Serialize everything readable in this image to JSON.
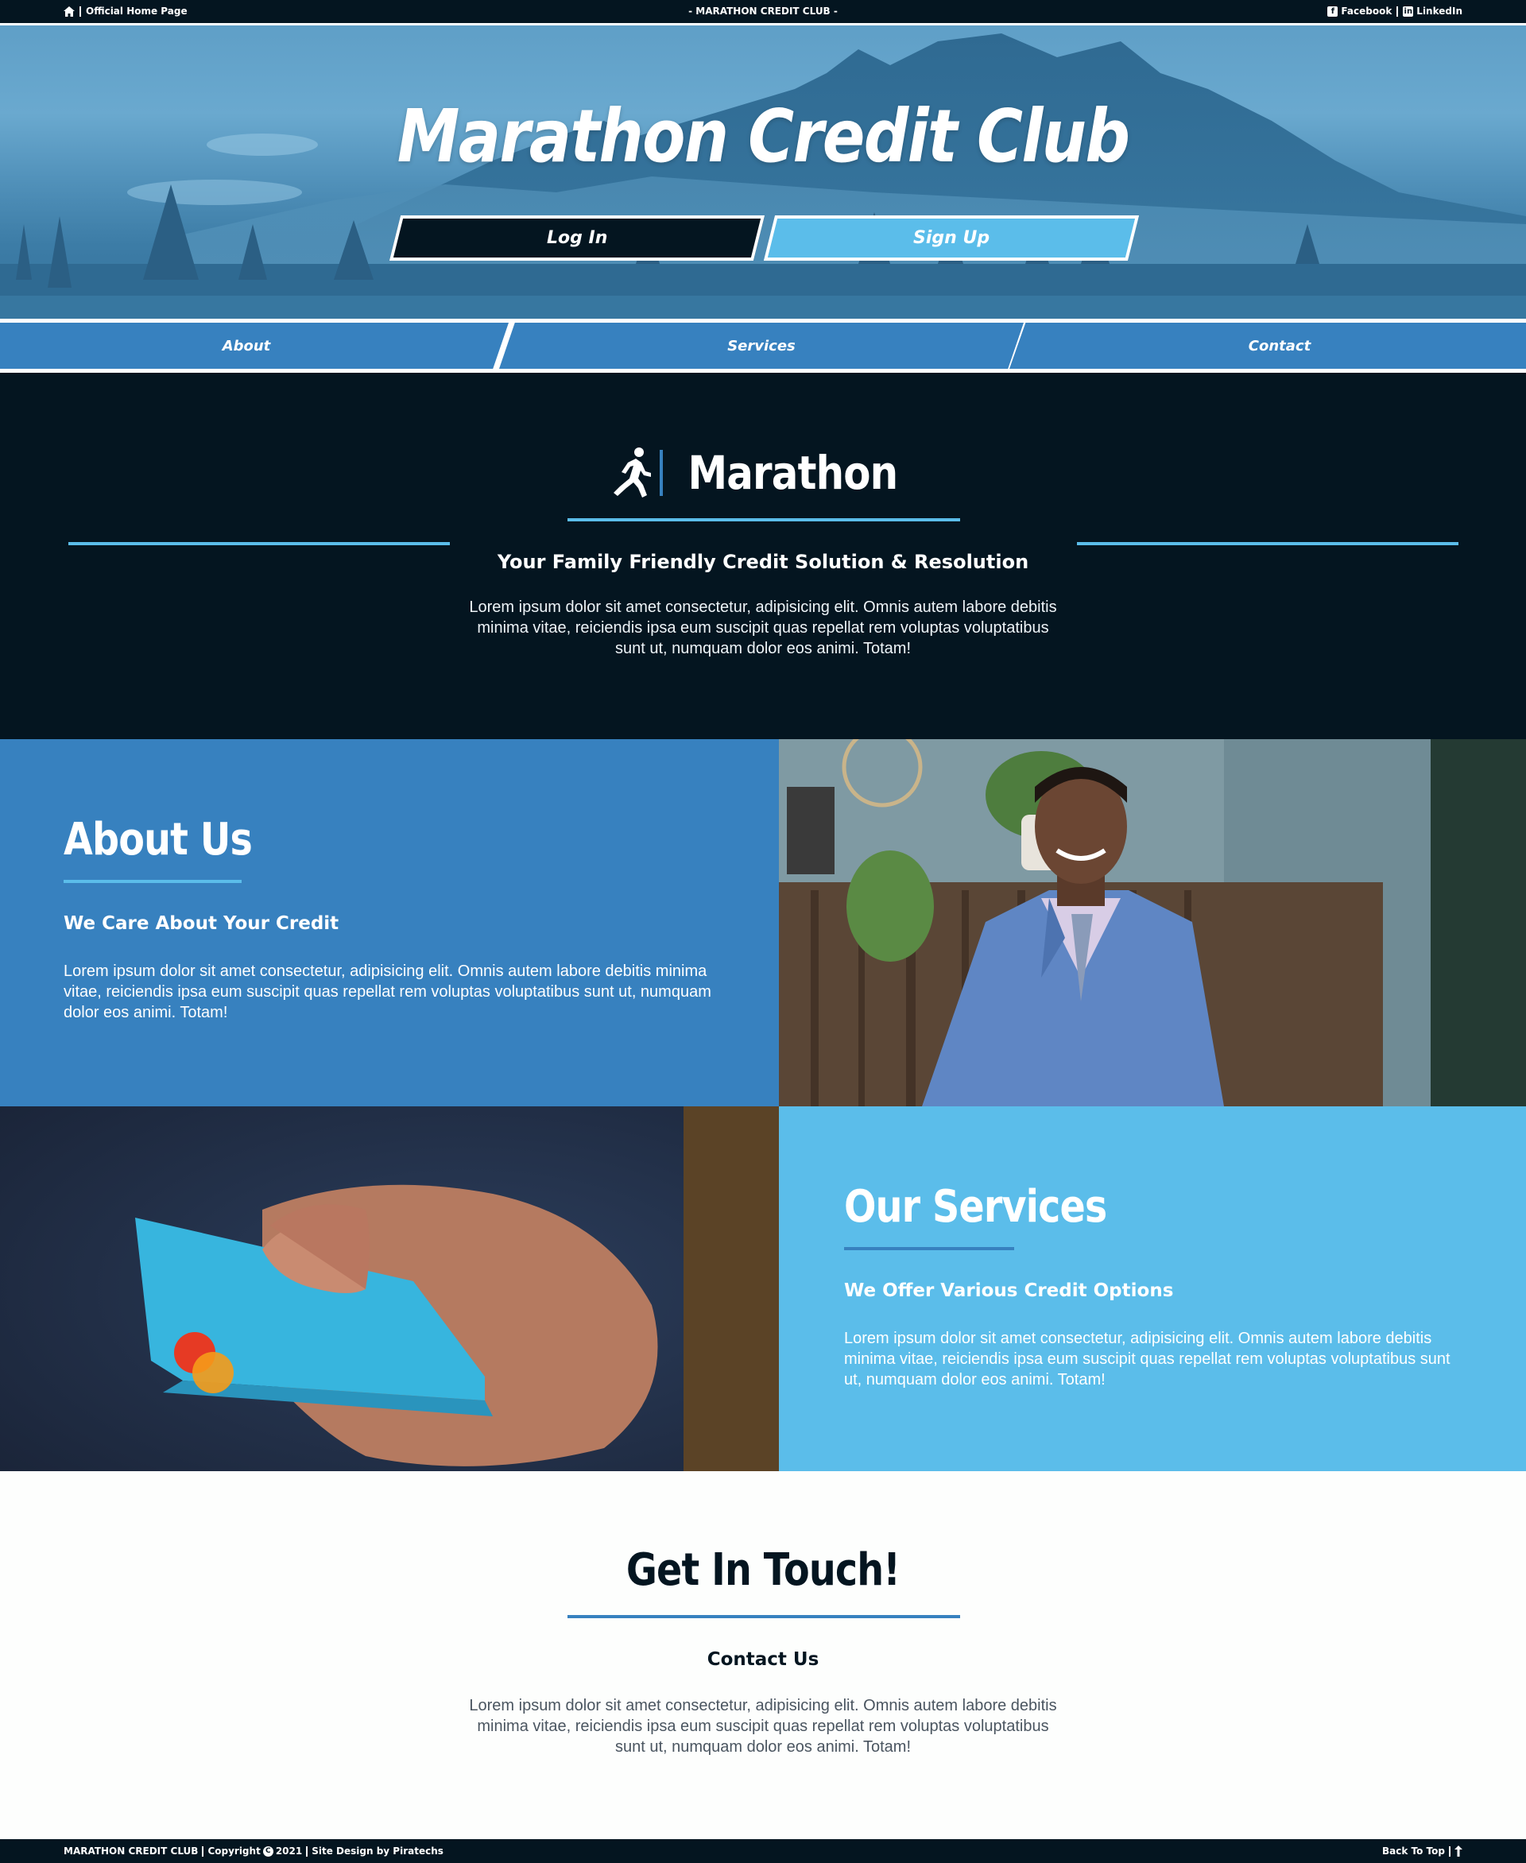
{
  "topbar": {
    "home_label": "Official Home Page",
    "center_label": "- MARATHON CREDIT CLUB -",
    "facebook_label": "Facebook",
    "linkedin_label": "LinkedIn"
  },
  "hero": {
    "title": "Marathon Credit Club",
    "login_label": "Log In",
    "signup_label": "Sign Up"
  },
  "nav": {
    "items": [
      {
        "label": "About"
      },
      {
        "label": "Services"
      },
      {
        "label": "Contact"
      }
    ]
  },
  "intro": {
    "brand": "Marathon",
    "subtitle": "Your Family Friendly Credit Solution & Resolution",
    "text": "Lorem ipsum dolor sit amet consectetur, adipisicing elit. Omnis autem labore debitis minima vitae, reiciendis ipsa eum suscipit quas repellat rem voluptas voluptatibus sunt ut, numquam dolor eos animi. Totam!"
  },
  "about": {
    "title": "About Us",
    "subtitle": "We Care About Your Credit",
    "text": "Lorem ipsum dolor sit amet consectetur, adipisicing elit. Omnis autem labore debitis minima vitae, reiciendis ipsa eum suscipit quas repellat rem voluptas voluptatibus sunt ut, numquam dolor eos animi. Totam!"
  },
  "services": {
    "title": "Our Services",
    "subtitle": "We Offer Various Credit Options",
    "text": "Lorem ipsum dolor sit amet consectetur, adipisicing elit. Omnis autem labore debitis minima vitae, reiciendis ipsa eum suscipit quas repellat rem voluptas voluptatibus sunt ut, numquam dolor eos animi. Totam!"
  },
  "contact": {
    "title": "Get In Touch!",
    "subtitle": "Contact Us",
    "text": "Lorem ipsum dolor sit amet consectetur, adipisicing elit. Omnis autem labore debitis minima vitae, reiciendis ipsa eum suscipit quas repellat rem voluptas voluptatibus sunt ut, numquam dolor eos animi. Totam!"
  },
  "footer": {
    "brand": "MARATHON CREDIT CLUB",
    "copyright_label": "Copyright",
    "year": "2021",
    "credit": "Site Design by Piratechs",
    "back_to_top": "Back To Top"
  },
  "colors": {
    "navy": "#041520",
    "blue": "#3781bf",
    "light_blue": "#5bbdea",
    "white": "#fdfefd"
  },
  "icons": [
    "home-icon",
    "facebook-icon",
    "linkedin-icon",
    "runner-icon",
    "copyright-icon",
    "arrow-up-icon"
  ]
}
